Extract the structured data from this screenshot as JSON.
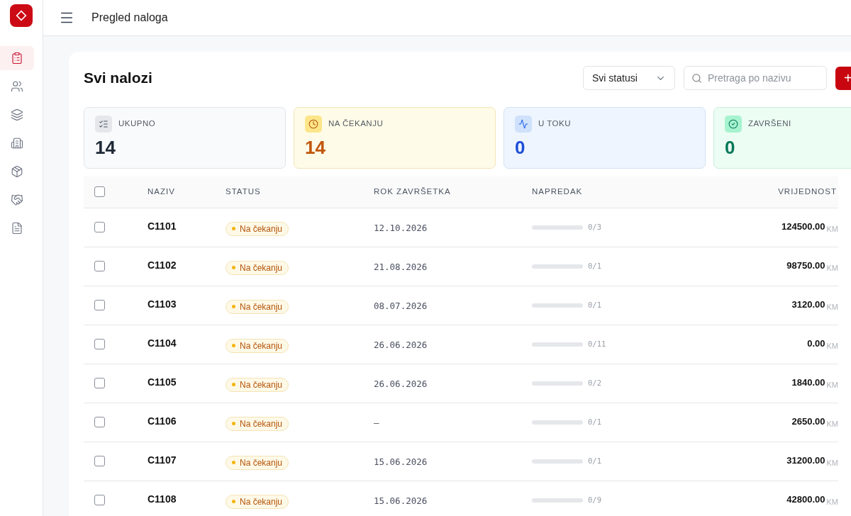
{
  "header": {
    "title": "Pregled naloga"
  },
  "sidebar": {
    "items": [
      {
        "kind": "orders",
        "selected": true
      },
      {
        "kind": "people",
        "selected": false
      },
      {
        "kind": "layers",
        "selected": false
      },
      {
        "kind": "building",
        "selected": false
      },
      {
        "kind": "box",
        "selected": false
      },
      {
        "kind": "handshake",
        "selected": false
      },
      {
        "kind": "document",
        "selected": false
      }
    ]
  },
  "page": {
    "title": "Svi nalozi",
    "status_filter": {
      "value": "Svi statusi"
    },
    "search": {
      "placeholder": "Pretraga po nazivu"
    },
    "add_button": {
      "label": "+"
    }
  },
  "stats": [
    {
      "kind": "total",
      "label": "UKUPNO",
      "value": "14"
    },
    {
      "kind": "pending",
      "label": "NA ČEKANJU",
      "value": "14"
    },
    {
      "kind": "active",
      "label": "U TOKU",
      "value": "0"
    },
    {
      "kind": "done",
      "label": "ZAVRŠENI",
      "value": "0"
    }
  ],
  "table": {
    "all_checked": false,
    "columns": [
      "NAZIV",
      "STATUS",
      "ROK ZAVRŠETKA",
      "NAPREDAK",
      "VRIJEDNOST"
    ],
    "rows": [
      {
        "checked": false,
        "name": "C1101",
        "status": "Na čekanju",
        "due": "12.10.2026",
        "level": 0,
        "progress": "0/3",
        "value": "124500.00",
        "currency": "KM"
      },
      {
        "checked": false,
        "name": "C1102",
        "status": "Na čekanju",
        "due": "21.08.2026",
        "level": 0,
        "progress": "0/1",
        "value": "98750.00",
        "currency": "KM"
      },
      {
        "checked": false,
        "name": "C1103",
        "status": "Na čekanju",
        "due": "08.07.2026",
        "level": 0,
        "progress": "0/1",
        "value": "3120.00",
        "currency": "KM"
      },
      {
        "checked": false,
        "name": "C1104",
        "status": "Na čekanju",
        "due": "26.06.2026",
        "level": 0,
        "progress": "0/11",
        "value": "0.00",
        "currency": "KM"
      },
      {
        "checked": false,
        "name": "C1105",
        "status": "Na čekanju",
        "due": "26.06.2026",
        "level": 0,
        "progress": "0/2",
        "value": "1840.00",
        "currency": "KM"
      },
      {
        "checked": false,
        "name": "C1106",
        "status": "Na čekanju",
        "due": "—",
        "level": 0,
        "progress": "0/1",
        "value": "2650.00",
        "currency": "KM"
      },
      {
        "checked": false,
        "name": "C1107",
        "status": "Na čekanju",
        "due": "15.06.2026",
        "level": 0,
        "progress": "0/1",
        "value": "31200.00",
        "currency": "KM"
      },
      {
        "checked": false,
        "name": "C1108",
        "status": "Na čekanju",
        "due": "15.06.2026",
        "level": 0,
        "progress": "0/9",
        "value": "42800.00",
        "currency": "KM"
      }
    ]
  }
}
